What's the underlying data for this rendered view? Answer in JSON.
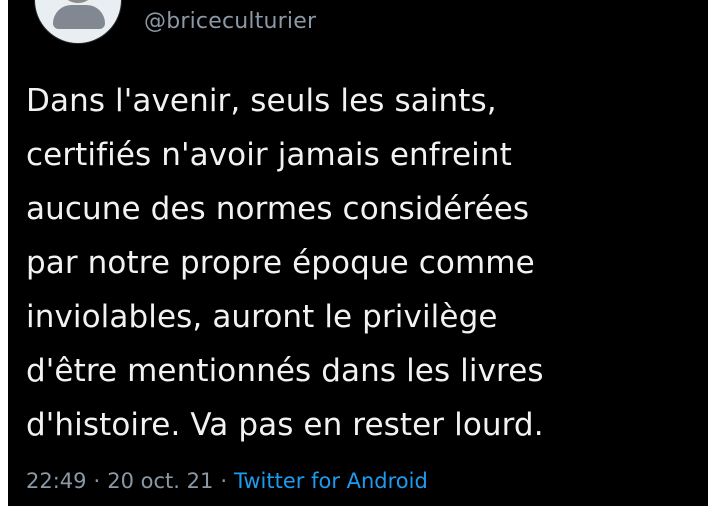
{
  "tweet": {
    "handle": "@briceculturier",
    "text_lines": [
      "Dans l'avenir, seuls les saints,",
      "certifiés n'avoir jamais enfreint",
      "aucune des normes considérées",
      "par notre propre époque comme",
      "inviolables, auront le privilège",
      "d'être mentionnés dans les livres",
      "d'histoire. Va pas en rester lourd."
    ],
    "time": "22:49",
    "date": "20 oct. 21",
    "separator": "·",
    "source": "Twitter for Android"
  },
  "colors": {
    "background": "#000000",
    "text": "#f2f2f2",
    "muted": "#8b98a5",
    "link": "#1d9bf0"
  },
  "icons": {
    "avatar": "profile-avatar"
  }
}
